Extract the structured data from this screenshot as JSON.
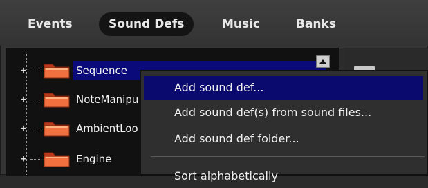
{
  "tabs": [
    {
      "label": "Events"
    },
    {
      "label": "Sound Defs"
    },
    {
      "label": "Music"
    },
    {
      "label": "Banks"
    }
  ],
  "active_tab": "Sound Defs",
  "tree": {
    "items": [
      {
        "label": "Sequence",
        "expander": "+",
        "icon": "folder-icon",
        "selected": true
      },
      {
        "label": "NoteManipu",
        "expander": "+",
        "icon": "folder-icon",
        "selected": false
      },
      {
        "label": "AmbientLoo",
        "expander": "+",
        "icon": "folder-icon",
        "selected": false
      },
      {
        "label": "Engine",
        "expander": "+",
        "icon": "folder-icon",
        "selected": false
      }
    ]
  },
  "context_menu": {
    "items": [
      {
        "label": "Add sound def...",
        "highlighted": true
      },
      {
        "label": "Add sound def(s) from sound files..."
      },
      {
        "label": "Add sound def folder..."
      },
      {
        "label": "Sort alphabetically"
      }
    ]
  },
  "colors": {
    "selection": "#0a0a7a",
    "folder": "#e8663a",
    "background": "#353535"
  }
}
